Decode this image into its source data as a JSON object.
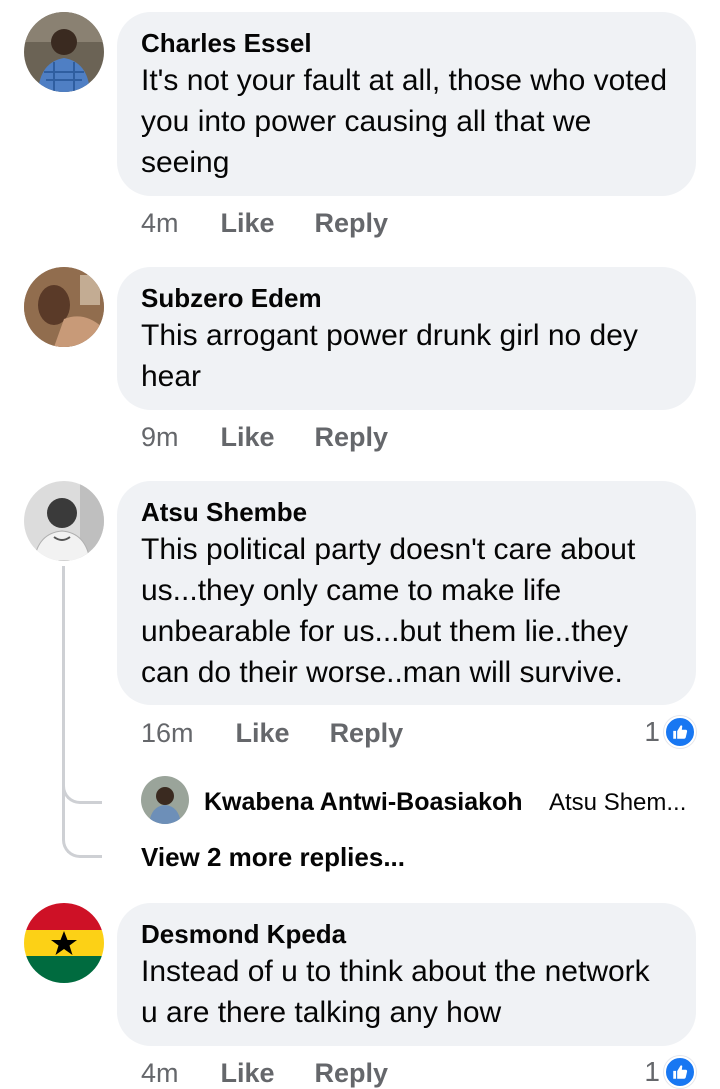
{
  "comments": [
    {
      "author": "Charles Essel",
      "text": "It's not your fault at all, those who voted you into power causing all that we seeing",
      "time": "4m",
      "like_label": "Like",
      "reply_label": "Reply"
    },
    {
      "author": "Subzero Edem",
      "text": "This arrogant power drunk girl no dey hear",
      "time": "9m",
      "like_label": "Like",
      "reply_label": "Reply"
    },
    {
      "author": "Atsu Shembe",
      "text": "This political party doesn't care about us...they only came to make life unbearable for us...but them lie..they can do their worse..man will survive.",
      "time": "16m",
      "like_label": "Like",
      "reply_label": "Reply",
      "reaction_count": "1",
      "reply": {
        "author": "Kwabena Antwi-Boasiakoh",
        "text": "Atsu Shem..."
      },
      "more_replies": "View 2 more replies..."
    },
    {
      "author": "Desmond Kpeda",
      "text": "Instead  of u to think  about  the network u are there talking any how",
      "time": "4m",
      "like_label": "Like",
      "reply_label": "Reply",
      "reaction_count": "1"
    }
  ],
  "icons": {
    "reaction": "like-thumb-icon"
  },
  "colors": {
    "bubble": "#f0f2f5",
    "meta_text": "#65676b",
    "like_blue": "#1877f2",
    "thread_line": "#ced0d4"
  }
}
